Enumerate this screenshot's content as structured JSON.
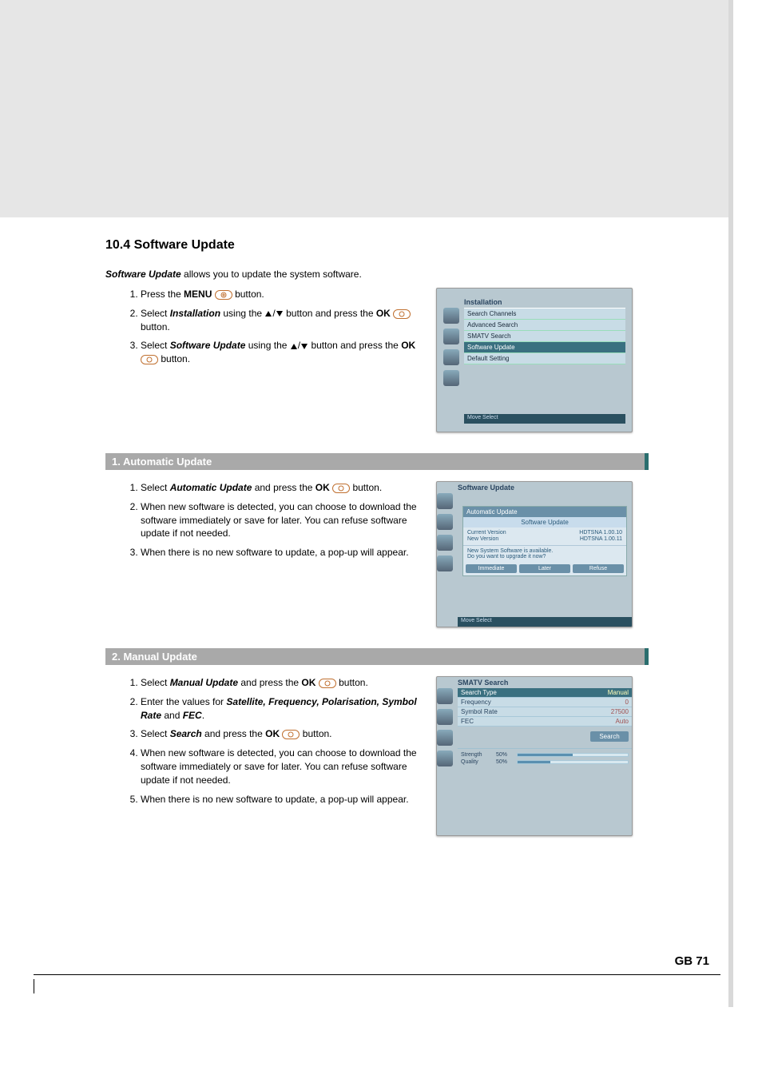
{
  "section_title": "10.4 Software Update",
  "intro_prefix": "Software Update",
  "intro_rest": " allows you to update the system software.",
  "steps_main": [
    {
      "pre": "Press the ",
      "b1": "MENU",
      "post": " button."
    },
    {
      "pre": "Select ",
      "b1": "Installation",
      "mid": " using the ",
      "post2": " button and press the ",
      "b2": "OK",
      "post": " button."
    },
    {
      "pre": "Select ",
      "b1": "Software Update",
      "mid": " using the ",
      "post2": " button and press the ",
      "b2": "OK",
      "post": " button."
    }
  ],
  "sub1": {
    "title": "1. Automatic Update"
  },
  "steps_auto": [
    {
      "pre": "Select ",
      "b1": "Automatic Update",
      "mid": " and press the ",
      "b2": "OK",
      "post": " button."
    },
    {
      "text": "When new software is detected, you can choose to download the software immediately or save for later. You can refuse software update if not needed."
    },
    {
      "text": "When there is no new software to update, a pop-up will appear."
    }
  ],
  "sub2": {
    "title": "2. Manual Update"
  },
  "steps_manual": [
    {
      "pre": "Select ",
      "b1": "Manual Update",
      "mid": " and press the ",
      "b2": "OK",
      "post": " button."
    },
    {
      "pre": "Enter the values for ",
      "b1": "Satellite, Frequency, Polarisation, Symbol Rate",
      "mid": " and ",
      "b2": "FEC",
      "post": "."
    },
    {
      "pre": "Select ",
      "b1": "Search",
      "mid": " and press the ",
      "b2": "OK",
      "post": " button."
    },
    {
      "text": "When new software is detected, you can choose to download the software immediately or save for later. You can refuse software update if not needed."
    },
    {
      "text": "When there is no new software to update, a pop-up will appear."
    }
  ],
  "fig1": {
    "title": "Installation",
    "items": [
      "Search Channels",
      "Advanced Search",
      "SMATV Search",
      "Software Update",
      "Default Setting"
    ],
    "selected": 3,
    "footer": "Move    Select"
  },
  "fig2": {
    "title": "Software Update",
    "menu_item": "Automatic Update",
    "popup_title": "Software Update",
    "current_label": "Current Version",
    "current_val": "HDTSNA  1.00.10",
    "new_label": "New Version",
    "new_val": "HDTSNA  1.00.11",
    "msg1": "New System Software is available.",
    "msg2": "Do you want to upgrade it now?",
    "btns": [
      "Immediate",
      "Later",
      "Refuse"
    ],
    "footer": "Move    Select"
  },
  "fig3": {
    "title": "SMATV Search",
    "fields": [
      {
        "label": "Search Type",
        "value": "Manual",
        "sel": true
      },
      {
        "label": "Frequency",
        "value": "0"
      },
      {
        "label": "Symbol Rate",
        "value": "27500"
      },
      {
        "label": "FEC",
        "value": "Auto"
      }
    ],
    "search": "Search",
    "strength_label": "Strength",
    "strength_pct": "50%",
    "strength_fill": 50,
    "quality_label": "Quality",
    "quality_pct": "50%",
    "quality_fill": 30
  },
  "page_number": "GB 71"
}
